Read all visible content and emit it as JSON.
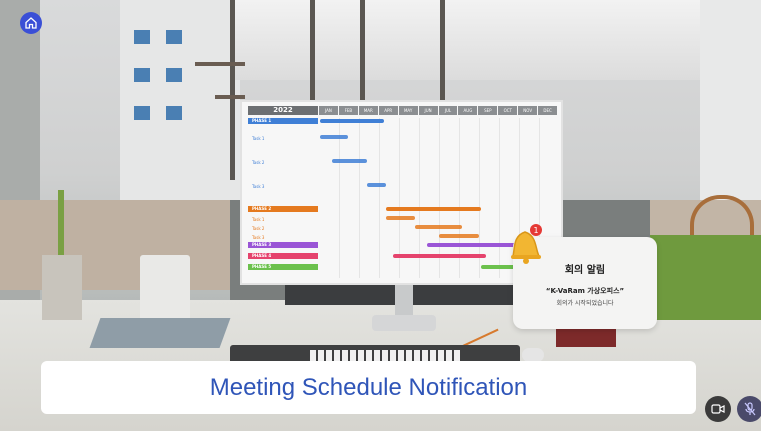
{
  "caption": {
    "text": "Meeting Schedule Notification"
  },
  "notification": {
    "title": "회의 알림",
    "line1": "“K-VaRam 가상오피스”",
    "line2": "회의가 시작되었습니다",
    "badge": "1"
  },
  "gantt": {
    "year": "2022",
    "months": [
      "JAN",
      "FEB",
      "MAR",
      "APR",
      "MAY",
      "JUN",
      "JUL",
      "AUG",
      "SEP",
      "OCT",
      "NOV",
      "DEC"
    ],
    "rows": [
      {
        "label": "PHASE 1",
        "phase": true,
        "color": "#3f7fd6"
      },
      {
        "label": "Task 1",
        "phase": false,
        "color": "#3f7fd6"
      },
      {
        "label": "Task 2",
        "phase": false,
        "color": "#3f7fd6"
      },
      {
        "label": "Task 3",
        "phase": false,
        "color": "#3f7fd6"
      },
      {
        "label": "PHASE 2",
        "phase": true,
        "color": "#e57a1f"
      },
      {
        "label": "Task 1",
        "phase": false,
        "color": "#e57a1f"
      },
      {
        "label": "Task 2",
        "phase": false,
        "color": "#e57a1f"
      },
      {
        "label": "Task 3",
        "phase": false,
        "color": "#e57a1f"
      },
      {
        "label": "PHASE 3",
        "phase": true,
        "color": "#9a55d6"
      },
      {
        "label": "PHASE 4",
        "phase": true,
        "color": "#e5436d"
      },
      {
        "label": "PHASE 5",
        "phase": true,
        "color": "#6cc14d"
      }
    ]
  },
  "icons": {
    "home": "home-icon",
    "video": "video-camera-icon",
    "mic": "microphone-icon",
    "bell": "bell-icon"
  },
  "colors": {
    "caption_text": "#2f55b8",
    "home_button": "#3a4fd6",
    "badge": "#e53935"
  }
}
